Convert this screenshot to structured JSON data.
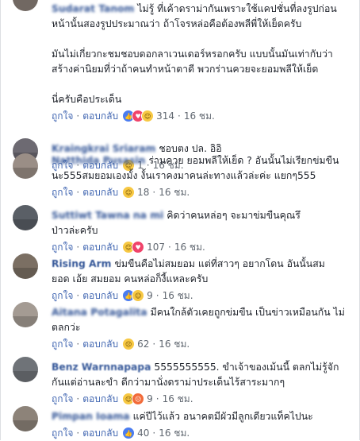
{
  "actions": {
    "like": "ถูกใจ",
    "reply": "ตอบกลับ",
    "sep": "·"
  },
  "comments": [
    {
      "name": "Sudarat Tanom",
      "lines": [
        "ไม่รู้ ที่เค้าดราม่ากันเพราะใช้แคปชั่นที่ลงรูปก่อน",
        "หน้านั้นสองรูปประมาณว่า ถ้าโจรหล่อคือต้องพลีพี่ให้เย็ดครับ",
        "",
        "มันไม่เกี่ยวกะชมชอบดอกลาเวนเดอร์หรอกครับ แบบนั้นมันเท่ากับว่า",
        "สร้างค่านิยมที่ว่าถ้าคนทำหน้าตาดี พวกร่านควยจะยอมพลีให้เย็ด",
        "",
        "นี่ครับคือประเด็น"
      ],
      "reactions": [
        "like",
        "love",
        "haha"
      ],
      "count": "314",
      "time": "16 ชม."
    },
    {
      "name": "Kraingkrai Sriaram",
      "lines": [
        "ชอบตง ปล. อิอิ"
      ],
      "reactions": [
        "haha"
      ],
      "count": "1",
      "time": "16 ชม."
    },
    {
      "name": "Natthida Pusasin",
      "lines": [
        "ร่านควย ยอมพลีให้เย็ด ? อันนั้นไม่เรียกข่มขืน",
        "นะ555สมยอมเองมั้ง งั้นเราคงมาคนล่ะทางแล้วล่ะค่ะ แยกๆ555"
      ],
      "reactions": [
        "haha"
      ],
      "count": "18",
      "time": "16 ชม."
    },
    {
      "name": "Suttiwt Tawna na mi",
      "lines": [
        "คิดว่าคนหล่อๆ จะมาข่มขืนคุณรึ",
        "ป่าวล่ะครับ"
      ],
      "reactions": [
        "haha",
        "love"
      ],
      "count": "107",
      "time": "16 ชม."
    },
    {
      "name": "Rising Arm",
      "lines": [
        "ข่มขืนคือไม่สมยอม แต่ที่สาวๆ อยากโดน อันนั้นสม",
        "ยอด เอ้ย สมยอม คนหล่อก็งี้แหละครับ"
      ],
      "reactions": [
        "like",
        "haha"
      ],
      "count": "9",
      "time": "16 ชม."
    },
    {
      "name": "Aitana Potagalita",
      "lines": [
        "มีคนใกล้ตัวเคยถูกข่มขืน เป็นข่าวเหมือนกัน ไม่",
        "ตลกว่ะ"
      ],
      "reactions": [
        "sad"
      ],
      "count": "62",
      "time": "16 ชม."
    },
    {
      "name": "Benz Warnnapapa",
      "lines": [
        "5555555555. ขำเจ้าของเม้นนี้ ตลกไม่รู้จัก",
        "กันแต่อ่านละขำ ดีกว่ามานั่งดราม่าประเด็นไร้สาระมากๆ"
      ],
      "reactions": [
        "haha",
        "angry"
      ],
      "count": "9",
      "time": "16 ชม."
    },
    {
      "name": "Pimpan Ioama",
      "lines": [
        "แค่ปีไว้แล้ว อนาคตมีผัวมีลูกเดียวแท็คไปนะ"
      ],
      "reactions": [
        "like"
      ],
      "count": "40",
      "time": "16 ชม."
    }
  ]
}
